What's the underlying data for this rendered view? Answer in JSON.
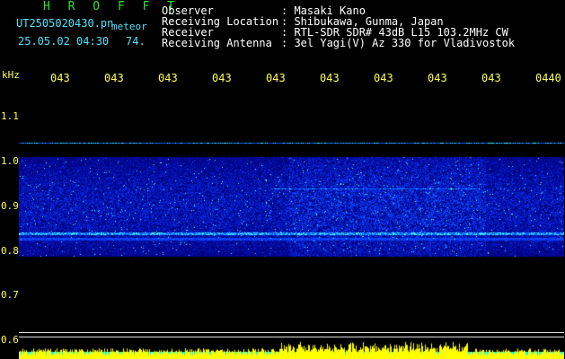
{
  "header": {
    "title": "H R O F F T",
    "filename": "UT2505020430.pn",
    "filename_suffix": "meteor",
    "datetime": "25.05.02 04:30",
    "count": "74."
  },
  "info": {
    "labels": [
      "Observer",
      "Receiving Location",
      "Receiver",
      "Receiving Antenna"
    ],
    "values": [
      ": Masaki Kano",
      ": Shibukawa, Gunma, Japan",
      ": RTL-SDR SDR# 43dB L15 103.2MHz CW",
      ": 3el Yagi(V) Az 330 for Vladivostok"
    ]
  },
  "axes": {
    "unit": "kHz",
    "y_ticks": [
      "1.1",
      "1.0",
      "0.9",
      "0.8",
      "0.7",
      "0.6"
    ],
    "x_ticks": [
      "043",
      "043",
      "043",
      "043",
      "043",
      "043",
      "043",
      "043",
      "043",
      "0440"
    ]
  },
  "colors": {
    "background": "#000000",
    "band": "#1d36ff",
    "amp_yellow": "#ffff00",
    "amp_cyan": "#00ffff"
  }
}
